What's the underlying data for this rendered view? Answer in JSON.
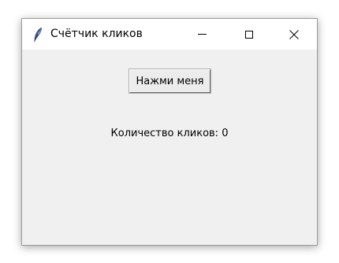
{
  "window": {
    "title": "Счётчик кликов",
    "icon": "feather-icon",
    "controls": {
      "minimize": "minimize-icon",
      "maximize": "maximize-icon",
      "close": "close-icon"
    }
  },
  "main": {
    "button_label": "Нажми меня",
    "counter_text": "Количество кликов: 0"
  },
  "colors": {
    "window_background": "#f0f0f0",
    "titlebar_background": "#ffffff"
  }
}
